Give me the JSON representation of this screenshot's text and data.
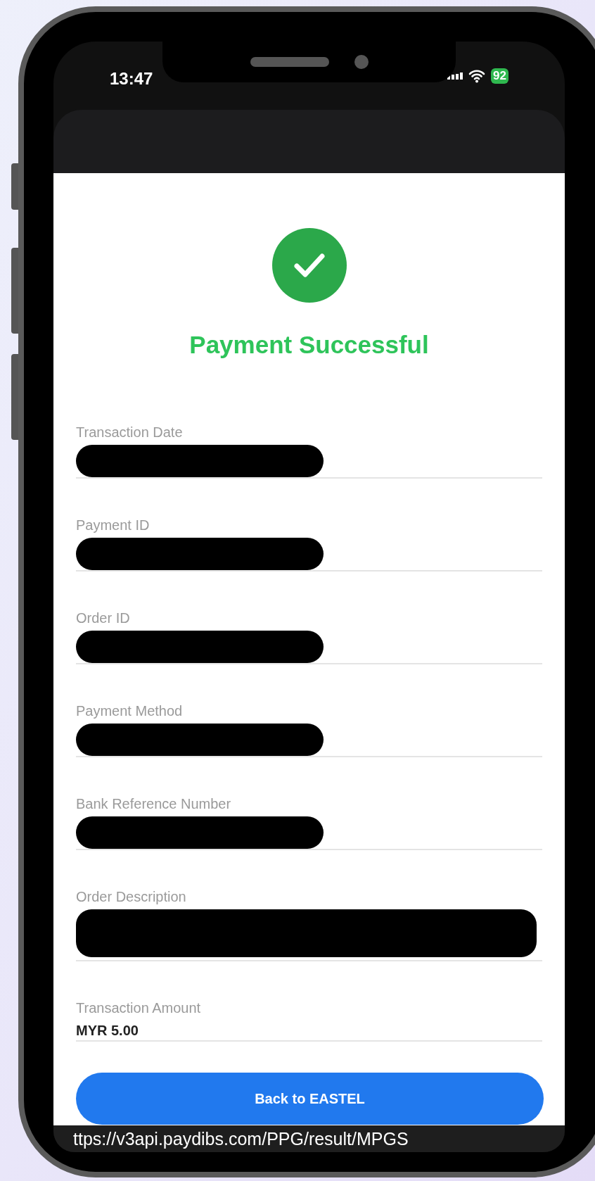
{
  "status_bar": {
    "time": "13:47",
    "battery": "92",
    "charging": true
  },
  "result": {
    "title": "Payment Successful",
    "success": true
  },
  "fields": [
    {
      "label": "Transaction Date",
      "kind": "redacted-short"
    },
    {
      "label": "Payment ID",
      "kind": "redacted-short"
    },
    {
      "label": "Order ID",
      "kind": "redacted-short"
    },
    {
      "label": "Payment Method",
      "kind": "redacted-short"
    },
    {
      "label": "Bank Reference Number",
      "kind": "redacted-short"
    },
    {
      "label": "Order Description",
      "kind": "redacted-long"
    },
    {
      "label": "Transaction Amount",
      "kind": "text",
      "value": "MYR 5.00"
    }
  ],
  "button": {
    "label": "Back to EASTEL"
  },
  "url_bar": {
    "text": "ttps://v3api.paydibs.com/PPG/result/MPGS"
  }
}
